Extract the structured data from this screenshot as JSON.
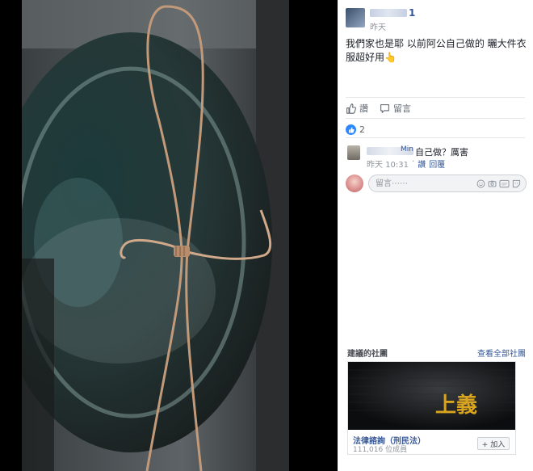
{
  "post": {
    "time": "昨天",
    "name_suffix": "1",
    "text": "我們家也是耶 以前阿公自己做的 曬大件衣服超好用",
    "text_emoji": "👆",
    "like_label": "讚",
    "comment_label": "留言"
  },
  "reactions": {
    "count": "2"
  },
  "comment": {
    "name_suffix": "Min",
    "text": "自己做？厲害",
    "time": "昨天 10:31",
    "sep": "·",
    "like_label": "讚",
    "reply_label": "回覆"
  },
  "comment_input": {
    "placeholder": "留言⋯⋯"
  },
  "suggested": {
    "title": "建議的社團",
    "see_all": "查看全部社團",
    "group_name": "法律諮詢（刑民法）",
    "members": "111,016 位成員",
    "join_label": "+ 加入",
    "banner_text": "上義"
  },
  "colors": {
    "link": "#365899",
    "like_blue": "#2d88ff",
    "meta_gray": "#90949c"
  }
}
